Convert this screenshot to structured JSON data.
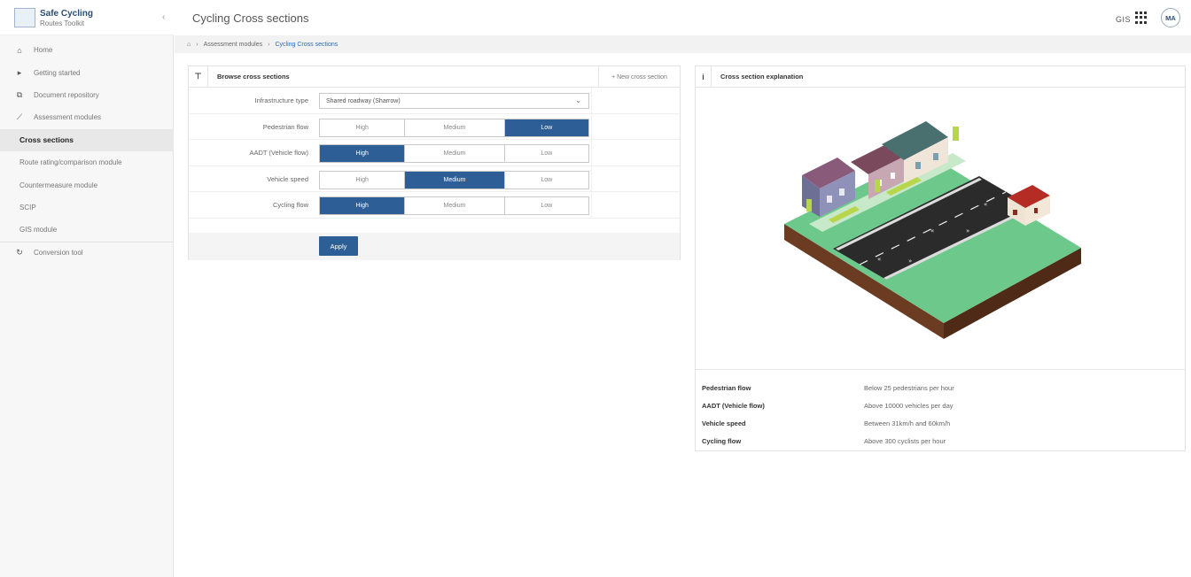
{
  "brand": {
    "title": "Safe Cycling",
    "subtitle": "Routes Toolkit"
  },
  "sidebar": {
    "collapse_glyph": "‹",
    "items": [
      {
        "label": "Home",
        "icon": "home-icon",
        "glyph": "⌂"
      },
      {
        "label": "Getting started",
        "icon": "pointer-icon",
        "glyph": "▸"
      },
      {
        "label": "Document repository",
        "icon": "documents-icon",
        "glyph": "⧉"
      },
      {
        "label": "Assessment modules",
        "icon": "chart-line-icon",
        "glyph": "⟋"
      },
      {
        "label": "Cross sections"
      },
      {
        "label": "Route rating/comparison module"
      },
      {
        "label": "Countermeasure module"
      },
      {
        "label": "SCIP"
      },
      {
        "label": "GIS module"
      },
      {
        "label": "Conversion tool",
        "icon": "refresh-icon",
        "glyph": "↻"
      }
    ]
  },
  "header": {
    "title": "Cycling Cross sections",
    "gis_label": "GIS",
    "avatar_initials": "MA"
  },
  "breadcrumb": {
    "home_glyph": "⌂",
    "separator": "›",
    "items": [
      "Assessment modules",
      "Cycling Cross sections"
    ]
  },
  "browse": {
    "title": "Browse cross sections",
    "filter_glyph": "⊤",
    "new_label": "+ New cross section",
    "infra_label": "Infrastructure type",
    "infra_value": "Shared roadway (Sharrow)",
    "chevron": "⌄",
    "rows": [
      {
        "label": "Pedestrian flow",
        "options": [
          "High",
          "Medium",
          "Low"
        ],
        "selected": "Low"
      },
      {
        "label": "AADT (Vehicle flow)",
        "options": [
          "High",
          "Medium",
          "Low"
        ],
        "selected": "High"
      },
      {
        "label": "Vehicle speed",
        "options": [
          "High",
          "Medium",
          "Low"
        ],
        "selected": "Medium"
      },
      {
        "label": "Cycling flow",
        "options": [
          "High",
          "Medium",
          "Low"
        ],
        "selected": "High"
      }
    ],
    "apply_label": "Apply"
  },
  "explain": {
    "title": "Cross section explanation",
    "info_glyph": "i",
    "rows": [
      {
        "label": "Pedestrian flow",
        "value": "Below 25 pedestrians per hour"
      },
      {
        "label": "AADT (Vehicle flow)",
        "value": "Above 10000 vehicles per day"
      },
      {
        "label": "Vehicle speed",
        "value": "Between 31km/h and 60km/h"
      },
      {
        "label": "Cycling flow",
        "value": "Above 300 cyclists per hour"
      }
    ]
  },
  "colors": {
    "accent": "#2d5f96",
    "grass": "#6dc88c",
    "road": "#2b2b2b",
    "soil": "#6b3b22"
  }
}
